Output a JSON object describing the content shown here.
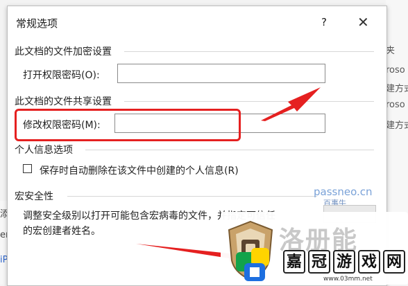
{
  "background": {
    "right_fragments": [
      "夹",
      "roso",
      "建方式",
      "roso",
      "建方式"
    ],
    "left_fragments": [
      "添",
      "er",
      "iP"
    ]
  },
  "dialog": {
    "title": "常规选项",
    "help_label": "?",
    "close_label": "✕",
    "encryption": {
      "section_title": "此文档的文件加密设置",
      "open_password_label": "打开权限密码(O):",
      "open_password_value": ""
    },
    "sharing": {
      "section_title": "此文档的文件共享设置",
      "modify_password_label": "修改权限密码(M):",
      "modify_password_value": ""
    },
    "privacy": {
      "section_title": "个人信息选项",
      "remove_info_label": "保存时自动删除在该文件中创建的个人信息(R)",
      "remove_info_checked": false
    },
    "macro": {
      "section_title": "宏安全性",
      "description_line1": "调整安全级别以打开可能包含宏病毒的文件，并指定可信任",
      "description_line2": "的宏创建者姓名。"
    }
  },
  "watermarks": {
    "passneo": "passneo.cn",
    "passneo_sub": "百事牛",
    "logo_title": "洛册能",
    "logo_chars": [
      "嘉",
      "冠",
      "游",
      "戏",
      "网"
    ],
    "logo_site": "www.03mm.net"
  },
  "colors": {
    "annotation_red": "#e52020"
  }
}
